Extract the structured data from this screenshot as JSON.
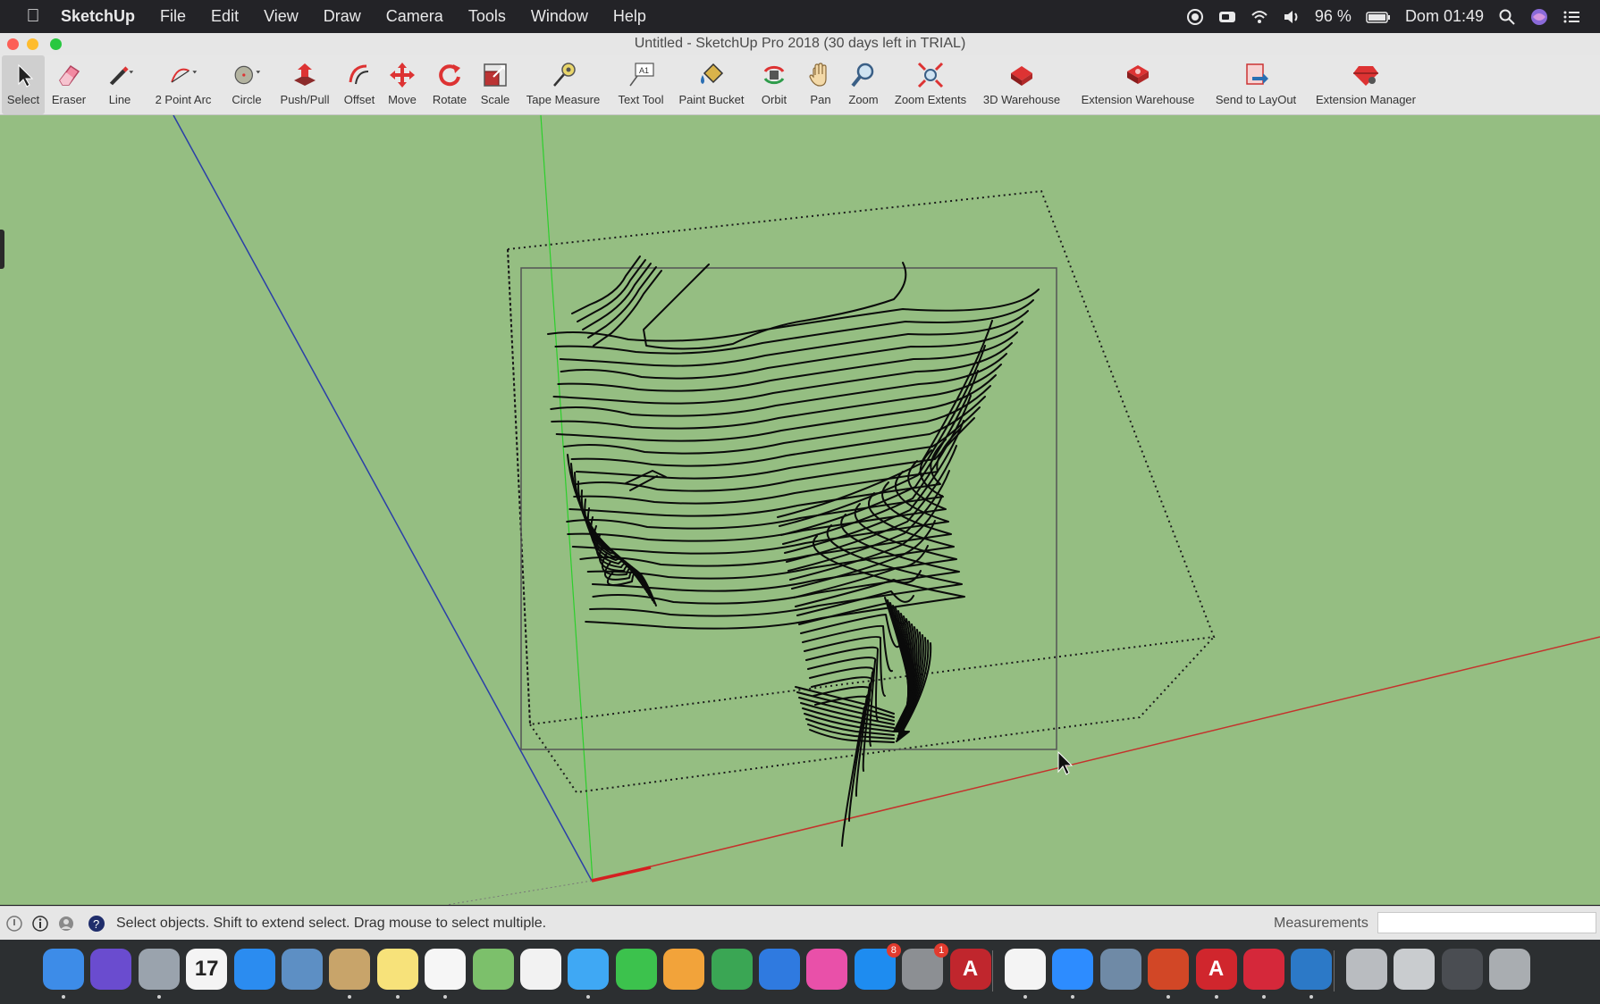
{
  "menubar": {
    "app_name": "SketchUp",
    "items": [
      "File",
      "Edit",
      "View",
      "Draw",
      "Camera",
      "Tools",
      "Window",
      "Help"
    ],
    "battery": "96 %",
    "clock": "Dom 01:49"
  },
  "window": {
    "title": "Untitled - SketchUp Pro 2018 (30 days left in TRIAL)"
  },
  "toolbar": {
    "tools": [
      {
        "label": "Select",
        "icon": "cursor-arrow-icon",
        "active": true
      },
      {
        "label": "Eraser",
        "icon": "eraser-icon"
      },
      {
        "label": "Line",
        "icon": "pencil-icon"
      },
      {
        "label": "2 Point Arc",
        "icon": "arc-icon"
      },
      {
        "label": "Circle",
        "icon": "circle-icon"
      },
      {
        "label": "Push/Pull",
        "icon": "push-pull-icon"
      },
      {
        "label": "Offset",
        "icon": "offset-icon"
      },
      {
        "label": "Move",
        "icon": "move-arrows-icon"
      },
      {
        "label": "Rotate",
        "icon": "rotate-icon"
      },
      {
        "label": "Scale",
        "icon": "scale-icon"
      },
      {
        "label": "Tape Measure",
        "icon": "tape-measure-icon"
      },
      {
        "label": "Text Tool",
        "icon": "text-tool-icon"
      },
      {
        "label": "Paint Bucket",
        "icon": "paint-bucket-icon"
      },
      {
        "label": "Orbit",
        "icon": "orbit-icon"
      },
      {
        "label": "Pan",
        "icon": "hand-icon"
      },
      {
        "label": "Zoom",
        "icon": "magnifier-icon"
      },
      {
        "label": "Zoom Extents",
        "icon": "zoom-extents-icon"
      },
      {
        "label": "3D Warehouse",
        "icon": "warehouse-icon"
      },
      {
        "label": "Extension Warehouse",
        "icon": "extension-warehouse-icon"
      },
      {
        "label": "Send to LayOut",
        "icon": "send-to-layout-icon"
      },
      {
        "label": "Extension Manager",
        "icon": "extension-manager-icon"
      }
    ]
  },
  "statusbar": {
    "hint": "Select objects. Shift to extend select. Drag mouse to select multiple.",
    "measurements_label": "Measurements",
    "measurements_value": ""
  },
  "dock": {
    "apps": [
      {
        "name": "finder-icon",
        "color": "#3d8ce8"
      },
      {
        "name": "siri-icon",
        "color": "#6a4ccf"
      },
      {
        "name": "launchpad-icon",
        "color": "#9aa3ad"
      },
      {
        "name": "calendar-icon",
        "color": "#f4f4f4",
        "text": "17"
      },
      {
        "name": "safari-icon",
        "color": "#2b8cf0"
      },
      {
        "name": "preview-icon",
        "color": "#5d8fc4"
      },
      {
        "name": "contacts-icon",
        "color": "#c8a46a"
      },
      {
        "name": "notes-icon",
        "color": "#f7e27a"
      },
      {
        "name": "reminders-icon",
        "color": "#f6f6f6"
      },
      {
        "name": "maps-icon",
        "color": "#7cc06b"
      },
      {
        "name": "photos-icon",
        "color": "#f2f2f2"
      },
      {
        "name": "messages-icon",
        "color": "#3fa8f4"
      },
      {
        "name": "facetime-icon",
        "color": "#3cc24d"
      },
      {
        "name": "pages-icon",
        "color": "#f2a33a"
      },
      {
        "name": "numbers-icon",
        "color": "#3aa654"
      },
      {
        "name": "keynote-icon",
        "color": "#2f7ae0"
      },
      {
        "name": "itunes-icon",
        "color": "#e950a9"
      },
      {
        "name": "app-store-icon",
        "color": "#1e8cf0",
        "badge": "8"
      },
      {
        "name": "system-preferences-icon",
        "color": "#8c8f93",
        "badge": "1"
      },
      {
        "name": "autocad-icon",
        "color": "#c0262d",
        "text": "A"
      },
      {
        "name": "chrome-icon",
        "color": "#f4f4f4"
      },
      {
        "name": "zoom-icon",
        "color": "#2d8cff"
      },
      {
        "name": "image-capture-icon",
        "color": "#6f8aa6"
      },
      {
        "name": "powerpoint-icon",
        "color": "#d24726"
      },
      {
        "name": "acrobat-icon",
        "color": "#d0262d",
        "text": "A"
      },
      {
        "name": "sketchup-icon",
        "color": "#d5283a"
      },
      {
        "name": "edge-icon",
        "color": "#2c79c7"
      },
      {
        "name": "document-stack-icon",
        "color": "#b9bcc0"
      },
      {
        "name": "screenshot-stack-icon",
        "color": "#c9cccf"
      },
      {
        "name": "downloads-stack-icon",
        "color": "#4a4d52"
      },
      {
        "name": "trash-icon",
        "color": "#a9adb1"
      }
    ]
  }
}
